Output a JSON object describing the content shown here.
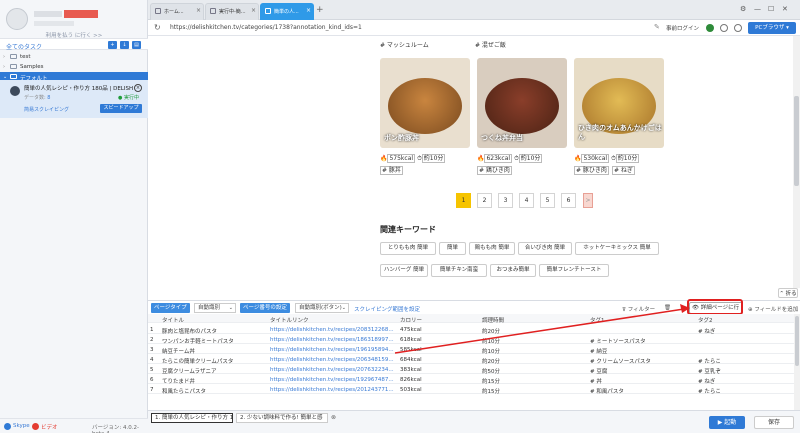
{
  "sidebar": {
    "back_link": "利用を払う に行く >>",
    "all_tasks": "全てのタスク",
    "tree": [
      {
        "label": "test"
      },
      {
        "label": "Samples"
      },
      {
        "label": "デフォルト"
      }
    ],
    "task": {
      "title": "簡単の人気レシピ・作り方 180品 | DELISH",
      "data_label": "データ数:",
      "data_value": "8",
      "status": "● 実行中",
      "mode": "简易スクレイピング",
      "speed_button": "スピードアップ"
    },
    "footer": {
      "skype": "Skype",
      "youtube": "ビデオ",
      "version": "バージョン: 4.0.2-beta.4"
    }
  },
  "tabs": [
    {
      "label": "ホーム..."
    },
    {
      "label": "実行中-簡..."
    },
    {
      "label": "簡単の人..."
    }
  ],
  "address": {
    "url": "https://delishkitchen.tv/categories/1738?annotation_kind_ids=1",
    "login": "事前ログイン",
    "pc_browser": "PCブラウザ"
  },
  "web": {
    "top_tags": [
      "# マッシュルーム",
      "# 混ぜご飯"
    ],
    "cards": [
      {
        "caption": "ポン酢豚丼",
        "kcal": "575kcal",
        "time": "約10分",
        "tags": [
          "# 豚丼"
        ],
        "c1": "#c9853f",
        "c2": "#7a4a1f"
      },
      {
        "caption": "つくね丼弁当",
        "kcal": "623kcal",
        "time": "約10分",
        "tags": [
          "# 鶏ひき肉"
        ],
        "c1": "#8a3e2a",
        "c2": "#4a2214"
      },
      {
        "caption": "ひき肉のオムあんかけごはん",
        "kcal": "530kcal",
        "time": "約10分",
        "tags": [
          "# 豚ひき肉",
          "# ねぎ"
        ],
        "c1": "#e2bb55",
        "c2": "#a8742a"
      }
    ],
    "pages": [
      "1",
      "2",
      "3",
      "4",
      "5",
      "6",
      ">"
    ],
    "keywords_title": "関連キーワード",
    "keywords_row1": [
      "とりもも肉 簡単",
      "簡単",
      "鶏もも肉 簡単",
      "合いびき肉 簡単",
      "ホットケーキミックス 簡単"
    ],
    "keywords_row2": [
      "ハンバーグ 簡単",
      "簡単チキン南蛮",
      "おつまみ簡単",
      "簡単フレンチトースト"
    ]
  },
  "toolbar": {
    "fold": "折る",
    "page_type_label": "ページタイプ",
    "page_type_value": "自動識別",
    "page_num_label": "ページ番号の設定",
    "page_num_value": "自動識別(ボタン)",
    "scroll_link": "スクレイピング範囲を設定",
    "filter": "フィルター",
    "detail_button": "詳細ページに行く",
    "add_field": "フィールドを追加"
  },
  "table": {
    "headers": [
      "タイトル",
      "タイトルリンク",
      "カロリー",
      "調理時間",
      "タグ1",
      "タグ2"
    ],
    "rows": [
      [
        "豚肉と塩昆布のパスタ",
        "https://delishkitchen.tv/recipes/208312268...",
        "475kcal",
        "約20分",
        "",
        "# ねぎ"
      ],
      [
        "ワンパンお手軽ミートパスタ",
        "https://delishkitchen.tv/recipes/186318997...",
        "618kcal",
        "約10分",
        "# ミートソースパスタ",
        ""
      ],
      [
        "納豆チーム丼",
        "https://delishkitchen.tv/recipes/196195894...",
        "585kcal",
        "約10分",
        "# 納豆",
        ""
      ],
      [
        "たらこの簡単クリームパスタ",
        "https://delishkitchen.tv/recipes/206348159...",
        "684kcal",
        "約20分",
        "# クリームソースパスタ",
        "# たらこ"
      ],
      [
        "豆腐クリームラザニア",
        "https://delishkitchen.tv/recipes/207632234...",
        "383kcal",
        "約50分",
        "# 豆腐",
        "# 豆乳ぞ"
      ],
      [
        "てりたまド井",
        "https://delishkitchen.tv/recipes/192967487...",
        "826kcal",
        "約15分",
        "# 丼",
        "# ねぎ"
      ],
      [
        "和風たらこパスタ",
        "https://delishkitchen.tv/recipes/201243771...",
        "503kcal",
        "約15分",
        "# 和風パスタ",
        "# たらこ"
      ]
    ]
  },
  "bottom": {
    "tab1": "1. 簡単の人気レシピ・作り方 180",
    "tab2": "2. 少ない調味料で作る! 簡単と感",
    "run": "起動",
    "save": "保存"
  }
}
